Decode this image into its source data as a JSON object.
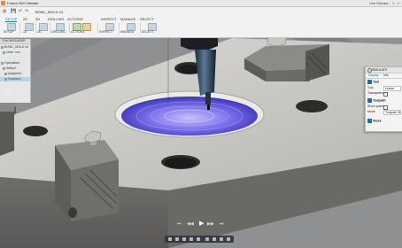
{
  "titlebar": {
    "title": "Fusion 360 Ultimate",
    "user": "Lee Grimes",
    "window_controls": "– □ ×"
  },
  "toolbar": {
    "document_name": "BOWL_MOLD v3",
    "quick_access": [
      "⊞",
      "💾",
      "↶",
      "↷"
    ],
    "tabs": [
      "SETUP",
      "2D",
      "3D",
      "DRILLING",
      "ACTIONS",
      "INSPECT",
      "MANAGE",
      "SELECT"
    ],
    "active_tab": "SETUP",
    "groups": [
      "SETUP",
      "2D",
      "3D",
      "DRILLING",
      "ACTIONS",
      "INSPECT",
      "MANAGE",
      "SELECT"
    ]
  },
  "browser": {
    "header": "CAM BROWSER",
    "items": [
      "BOWL_MOLD v3",
      "Units: mm",
      "Operations",
      "Setup1",
      "Adaptive1",
      "Contour2"
    ],
    "selected_index": 5
  },
  "panel": {
    "title": "SIMULATE",
    "tabs": [
      "Display",
      "Info"
    ],
    "tool_section": "Tool",
    "tool_mode_label": "Tool",
    "tool_mode_value": "Holder",
    "transparent_label": "Transparent",
    "toolpath_section": "Toolpath",
    "show_points_label": "Show points",
    "mode_label": "Mode",
    "mode_value": "Toolpath Simulation",
    "stock_section": "Stock"
  },
  "sim_controls": {
    "icons": [
      "⏮",
      "◀◀",
      "▶",
      "▶▶",
      "⏭"
    ]
  },
  "colors": {
    "accent": "#1473b8",
    "toolpath": "#5a4fd8",
    "table": "#8e9092"
  }
}
